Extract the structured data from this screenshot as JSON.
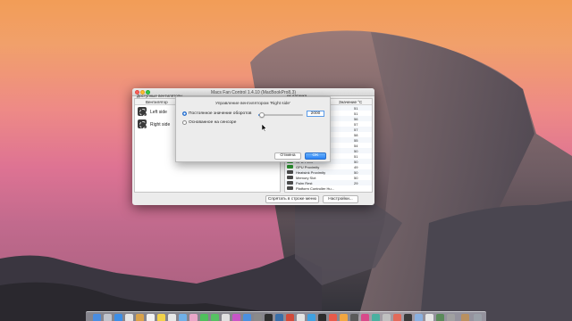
{
  "window": {
    "title": "Macs Fan Control 1.4.10 (MacBookPro8,3)"
  },
  "fans": {
    "header_available": "Доступные вентиляторы",
    "header_fan": "Вентилятор",
    "items": [
      {
        "name": "Left side"
      },
      {
        "name": "Right side"
      }
    ]
  },
  "sensors": {
    "header_partial": "ки датчика",
    "header_value": "Значение °C",
    "rows": [
      {
        "name": "",
        "value": "51",
        "icon": "chip-icon"
      },
      {
        "name": "",
        "value": "51",
        "icon": "chip-icon"
      },
      {
        "name": "",
        "value": "56",
        "icon": "chip-icon"
      },
      {
        "name": "",
        "value": "57",
        "icon": "chip-icon"
      },
      {
        "name": "",
        "value": "57",
        "icon": "chip-icon"
      },
      {
        "name": "",
        "value": "58",
        "icon": "chip-icon"
      },
      {
        "name": "",
        "value": "55",
        "icon": "chip-icon"
      },
      {
        "name": "",
        "value": "54",
        "icon": "chip-icon"
      },
      {
        "name": "",
        "value": "50",
        "icon": "chip-icon"
      },
      {
        "name": "",
        "value": "51",
        "icon": "chip-icon"
      },
      {
        "name": "GPU PECI",
        "value": "50",
        "icon": "gpu-icon"
      },
      {
        "name": "GPU Proximity",
        "value": "49",
        "icon": "gpu-icon"
      },
      {
        "name": "Heatsink Proximity",
        "value": "50",
        "icon": "chip-icon"
      },
      {
        "name": "Memory Slot",
        "value": "50",
        "icon": "chip-icon"
      },
      {
        "name": "Palm Rest",
        "value": "29",
        "icon": "chip-icon"
      },
      {
        "name": "Platform Controller Hu...",
        "value": "",
        "icon": "chip-icon"
      }
    ]
  },
  "buttons": {
    "hide_to_menu": "Спрятать в строке меню",
    "preferences": "Настройки..."
  },
  "sheet": {
    "title": "Управление вентилятором 'Right side'",
    "option_constant": "Постоянное значение оборотов",
    "option_sensor": "Основанное на сенсоре",
    "rpm_value": "2000",
    "slider_fraction": 0.08,
    "cancel": "Отмена",
    "ok": "OK"
  },
  "colors": {
    "accent": "#3a86e6",
    "close": "#fc5f57",
    "minimize": "#fdbc2e",
    "maximize": "#33c748"
  }
}
